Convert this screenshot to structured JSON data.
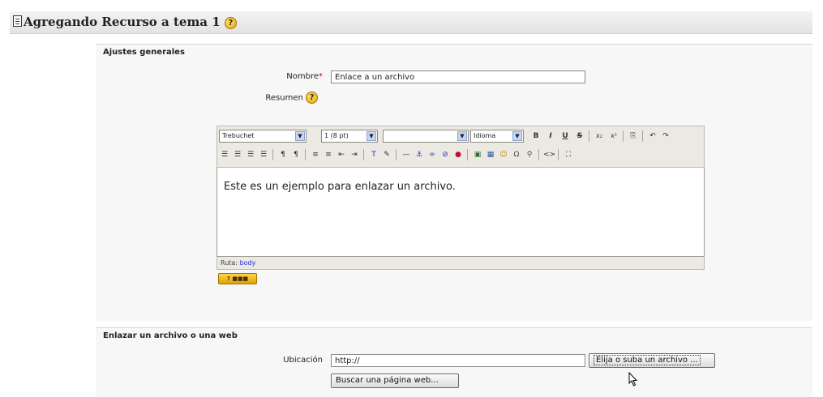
{
  "header": {
    "title": "Agregando Recurso a tema 1",
    "help_glyph": "?"
  },
  "general": {
    "legend": "Ajustes generales",
    "name_label": "Nombre",
    "required_mark": "*",
    "name_value": "Enlace a un archivo",
    "summary_label": "Resumen",
    "help_glyph": "?"
  },
  "editor": {
    "font_select": "Trebuchet",
    "size_select": "1 (8 pt)",
    "style_select": "",
    "lang_select": "Idioma",
    "content": "Este es un ejemplo para enlazar un archivo.",
    "path_label": "Ruta:",
    "path_value": "body",
    "help_badge": "? ■■■"
  },
  "link": {
    "legend": "Enlazar un archivo o una web",
    "location_label": "Ubicación",
    "location_value": "http://",
    "choose_button": "Elija o suba un archivo ...",
    "search_button": "Buscar una página web..."
  }
}
